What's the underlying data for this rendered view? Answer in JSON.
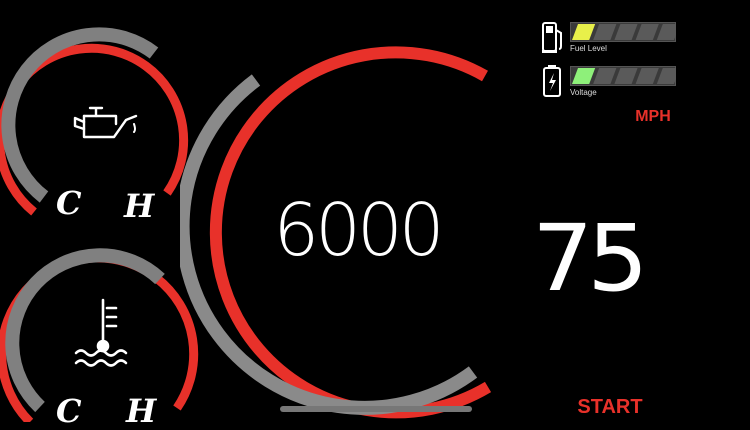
{
  "oil_gauge": {
    "icon": "oil-can-icon",
    "cold_label": "C",
    "hot_label": "H"
  },
  "coolant_gauge": {
    "icon": "coolant-temperature-icon",
    "cold_label": "C",
    "hot_label": "H"
  },
  "tachometer": {
    "value": "6000"
  },
  "fuel_level": {
    "icon": "fuel-pump-icon",
    "label": "Fuel Level",
    "segments": 5,
    "filled": 1,
    "fill_color": "#e8f04a"
  },
  "voltage": {
    "icon": "battery-icon",
    "label": "Voltage",
    "segments": 5,
    "filled": 1,
    "fill_color": "#8ef07a"
  },
  "speedometer": {
    "value": "75",
    "unit": "MPH"
  },
  "controls": {
    "start_label": "START"
  },
  "colors": {
    "accent": "#e8312a",
    "track": "#808080",
    "background": "#000000"
  }
}
